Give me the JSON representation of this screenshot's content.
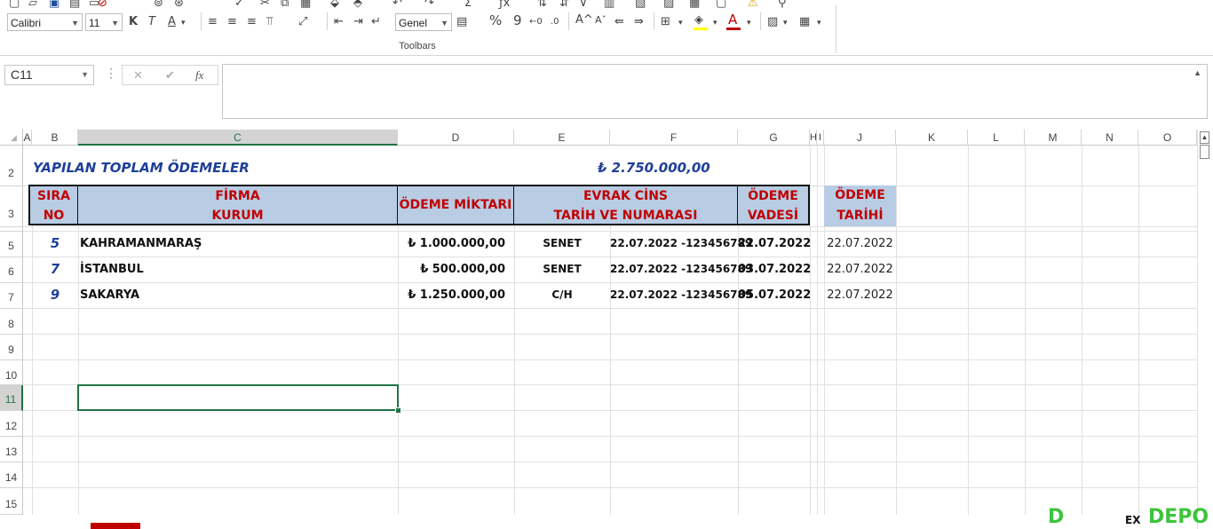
{
  "ribbon": {
    "font_name": "Calibri",
    "font_size": "11",
    "number_format": "Genel",
    "bold": "K",
    "italic": "T",
    "underline": "A",
    "percent": "%",
    "comma": "9",
    "toolbars_label": "Toolbars",
    "fill_color": "#ffff00",
    "font_color": "#c00000"
  },
  "formula_bar": {
    "name_box": "C11",
    "cancel": "✕",
    "enter": "✔",
    "fx": "fx",
    "formula": ""
  },
  "columns": [
    "A",
    "B",
    "C",
    "D",
    "E",
    "F",
    "G",
    "H",
    "I",
    "J",
    "K",
    "L",
    "M",
    "N",
    "O"
  ],
  "rows": [
    "2",
    "3",
    "5",
    "6",
    "7",
    "8",
    "9",
    "10",
    "11",
    "12",
    "13",
    "14",
    "15"
  ],
  "sheet": {
    "title": "YAPILAN TOPLAM ÖDEMELER",
    "total": "₺ 2.750.000,00",
    "headers": {
      "sira": [
        "SIRA",
        "NO"
      ],
      "firma": [
        "FİRMA",
        "KURUM"
      ],
      "odeme_miktari": "ÖDEME MİKTARI",
      "evrak": [
        "EVRAK CİNS",
        "TARİH VE NUMARASI"
      ],
      "vade": [
        "ÖDEME",
        "VADESİ"
      ],
      "odeme_tarihi": [
        "ÖDEME",
        "TARİHİ"
      ]
    },
    "records": [
      {
        "no": "5",
        "firma": "KAHRAMANMARAŞ",
        "miktar": "₺ 1.000.000,00",
        "cins": "SENET",
        "evrak": "22.07.2022 -123456789",
        "vade": "22.07.2022",
        "tarih": "22.07.2022"
      },
      {
        "no": "7",
        "firma": "İSTANBUL",
        "miktar": "₺ 500.000,00",
        "cins": "SENET",
        "evrak": "22.07.2022 -123456789",
        "vade": "03.07.2022",
        "tarih": "22.07.2022"
      },
      {
        "no": "9",
        "firma": "SAKARYA",
        "miktar": "₺ 1.250.000,00",
        "cins": "C/H",
        "evrak": "22.07.2022 -123456789",
        "vade": "05.07.2022",
        "tarih": "22.07.2022"
      }
    ]
  },
  "watermark": {
    "left": "D",
    "right": "DEPO",
    "mid": "EX"
  },
  "colors": {
    "header_fill": "#b8cce4",
    "header_text": "#c00000",
    "title_blue": "#1f3f9a",
    "selection": "#217346"
  }
}
